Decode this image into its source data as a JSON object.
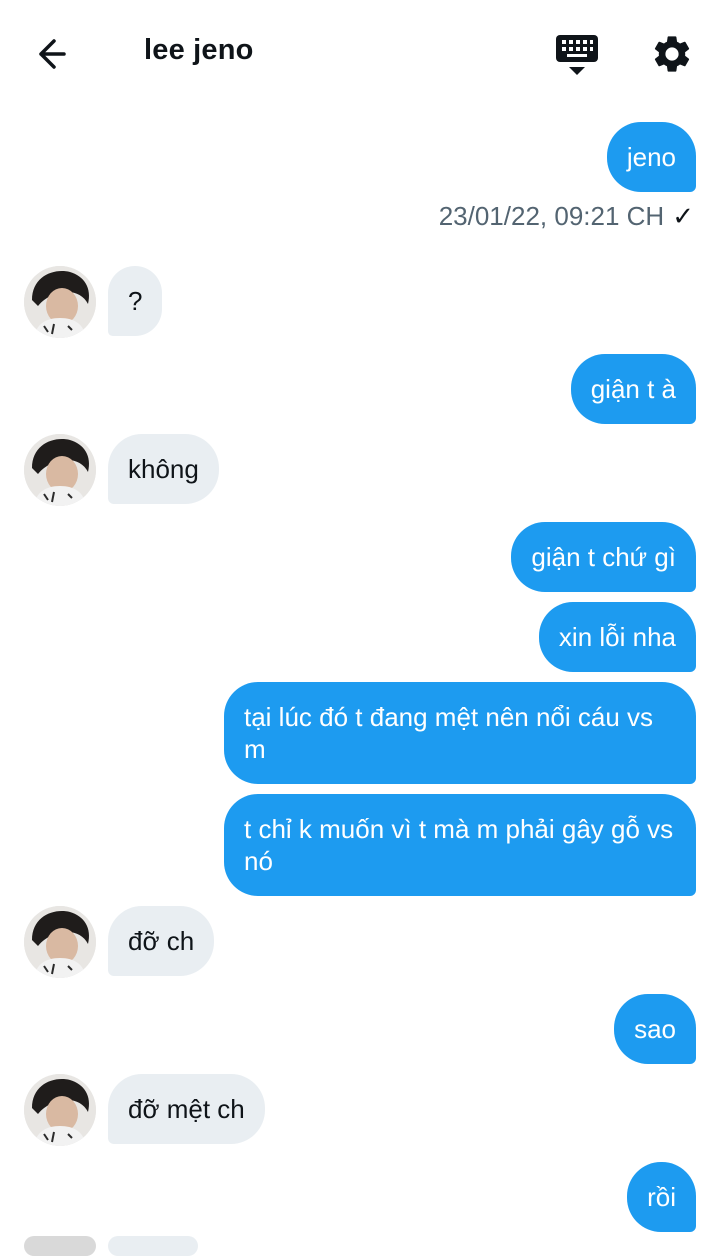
{
  "header": {
    "title": "lee jeno",
    "icons": {
      "back": "arrow-left-icon",
      "keyboard": "keyboard-icon",
      "settings": "gear-icon"
    }
  },
  "colors": {
    "outgoing": "#1d9bf0",
    "incoming": "#e9eef2",
    "text": "#0f1419",
    "muted": "#536471"
  },
  "messages": [
    {
      "dir": "out",
      "text": "jeno"
    },
    {
      "dir": "in",
      "text": "?"
    },
    {
      "dir": "out",
      "text": "giận t à"
    },
    {
      "dir": "in",
      "text": "không"
    },
    {
      "dir": "out",
      "text": "giận t chứ gì"
    },
    {
      "dir": "out",
      "text": "xin lỗi nha"
    },
    {
      "dir": "out",
      "text": "tại lúc đó t đang mệt nên nổi cáu vs m"
    },
    {
      "dir": "out",
      "text": "t chỉ k muốn vì t mà m phải gây gỗ vs nó"
    },
    {
      "dir": "in",
      "text": "đỡ ch"
    },
    {
      "dir": "out",
      "text": "sao"
    },
    {
      "dir": "in",
      "text": "đỡ mệt ch"
    },
    {
      "dir": "out",
      "text": "rồi"
    }
  ],
  "timestamp": {
    "text": "23/01/22, 09:21 CH",
    "check": "✓"
  }
}
